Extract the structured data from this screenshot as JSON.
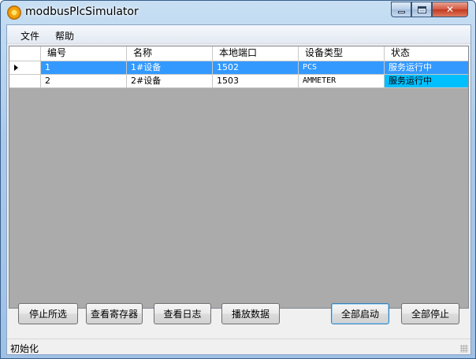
{
  "window": {
    "title": "modbusPlcSimulator"
  },
  "menu": {
    "items": [
      "文件",
      "帮助"
    ]
  },
  "table": {
    "columns": [
      "编号",
      "名称",
      "本地端口",
      "设备类型",
      "状态"
    ],
    "rows": [
      {
        "id": "1",
        "name": "1#设备",
        "port": "1502",
        "type": "PCS",
        "status": "服务运行中",
        "selected": true
      },
      {
        "id": "2",
        "name": "2#设备",
        "port": "1503",
        "type": "AMMETER",
        "status": "服务运行中",
        "selected": false
      }
    ]
  },
  "buttons": {
    "stop_selected": "停止所选",
    "view_registers": "查看寄存器",
    "view_log": "查看日志",
    "play_data": "播放数据",
    "start_all": "全部启动",
    "stop_all": "全部停止"
  },
  "status": {
    "text": "初始化"
  },
  "colors": {
    "selection": "#3399ff",
    "status_highlight": "#00bfff",
    "grid_background": "#ababab"
  }
}
